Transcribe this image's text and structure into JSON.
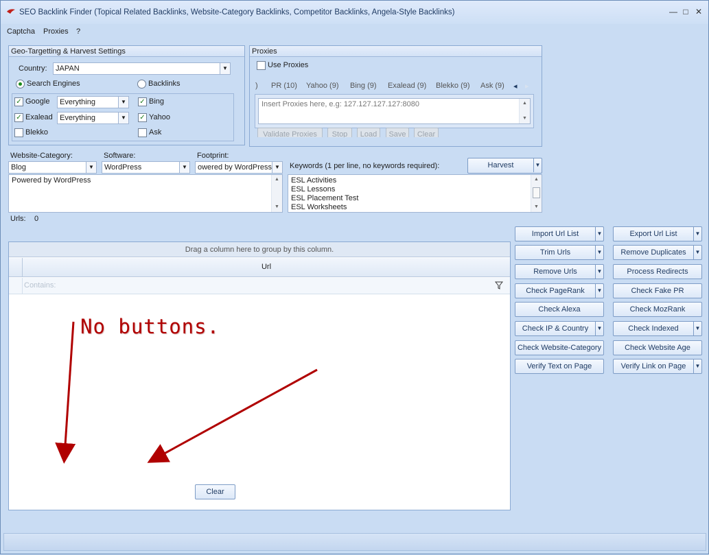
{
  "window": {
    "title": "SEO Backlink Finder (Topical Related Backlinks, Website-Category Backlinks, Competitor Backlinks, Angela-Style Backlinks)",
    "min_glyph": "—",
    "max_glyph": "□",
    "close_glyph": "✕"
  },
  "menu": [
    "Captcha",
    "Proxies",
    "?"
  ],
  "geo": {
    "header": "Geo-Targetting  & Harvest Settings",
    "country_label": "Country:",
    "country_value": "JAPAN",
    "radio_search_engines": "Search Engines",
    "radio_backlinks": "Backlinks",
    "engines": [
      {
        "label": "Google",
        "checked": true,
        "mode": "Everything"
      },
      {
        "label": "Bing",
        "checked": true
      },
      {
        "label": "Exalead",
        "checked": true,
        "mode": "Everything"
      },
      {
        "label": "Yahoo",
        "checked": true
      },
      {
        "label": "Blekko",
        "checked": false
      },
      {
        "label": "Ask",
        "checked": false
      }
    ]
  },
  "proxies": {
    "header": "Proxies",
    "use_label": "Use Proxies",
    "tabs": [
      ")",
      "PR (10)",
      "Yahoo (9)",
      "Bing (9)",
      "Exalead (9)",
      "Blekko (9)",
      "Ask (9)"
    ],
    "placeholder": "Insert Proxies here, e.g: 127.127.127.127:8080",
    "buttons": [
      "Validate Proxies",
      "Stop",
      "Load",
      "Save",
      "Clear"
    ]
  },
  "website": {
    "category_label": "Website-Category:",
    "category_value": "Blog",
    "software_label": "Software:",
    "software_value": "WordPress",
    "footprint_label": "Footprint:",
    "footprint_value": "owered by WordPress",
    "footprint_text": "Powered by WordPress",
    "keywords_label": "Keywords (1 per line, no keywords required):",
    "keywords": [
      "ESL Activities",
      "ESL Lessons",
      "ESL Placement Test",
      "ESL Worksheets"
    ],
    "harvest_label": "Harvest"
  },
  "urls": {
    "label": "Urls:",
    "count": "0"
  },
  "grid": {
    "group_hint": "Drag a column here to group by this column.",
    "column": "Url",
    "filter_placeholder": "Contains:",
    "clear_label": "Clear"
  },
  "tools_left": [
    "Import Url List",
    "Trim Urls",
    "Remove Urls",
    "Check PageRank",
    "Check Alexa",
    "Check IP & Country",
    "Check Website-Category",
    "Verify Text on Page"
  ],
  "tools_right": [
    "Export Url List",
    "Remove Duplicates",
    "Process Redirects",
    "Check Fake PR",
    "Check MozRank",
    "Check Indexed",
    "Check Website Age",
    "Verify Link on Page"
  ],
  "annotation": "No buttons.",
  "colors": {
    "annotation": "#b00000",
    "check": "#1a7a1a"
  }
}
